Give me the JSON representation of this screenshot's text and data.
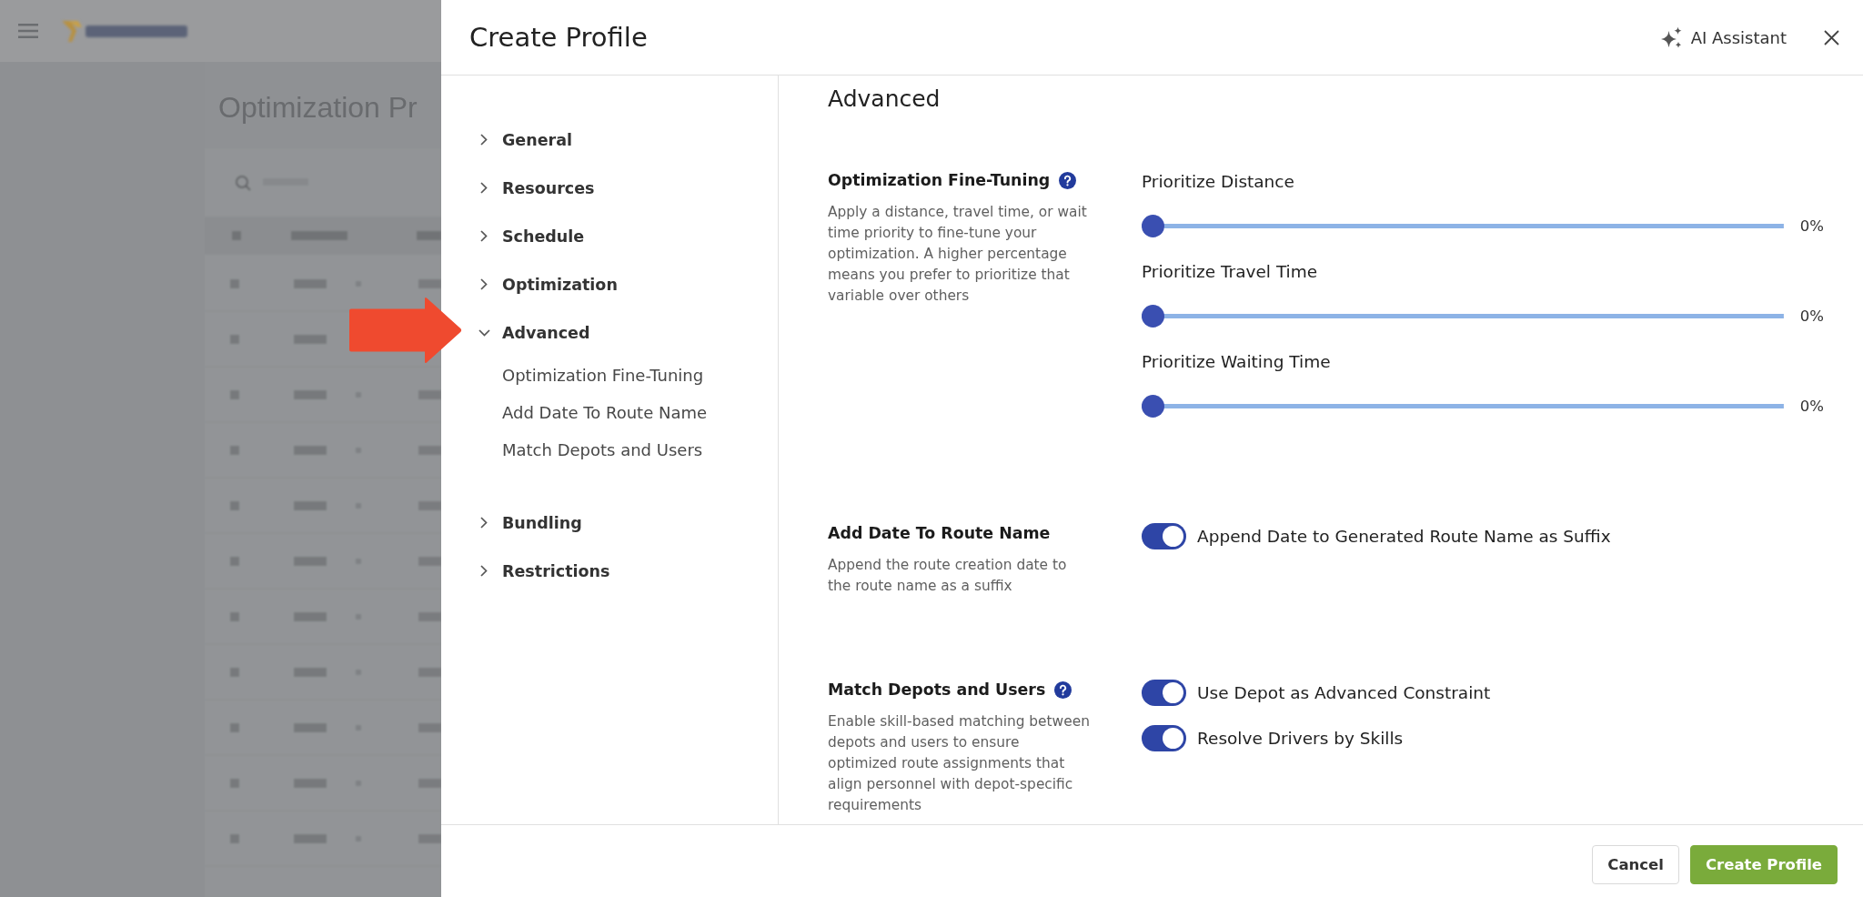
{
  "backdrop": {
    "page_title": "Optimization Pr"
  },
  "drawer": {
    "title": "Create Profile",
    "assistant_button": "AI Assistant"
  },
  "nav": {
    "items": [
      {
        "label": "General",
        "expanded": false
      },
      {
        "label": "Resources",
        "expanded": false
      },
      {
        "label": "Schedule",
        "expanded": false
      },
      {
        "label": "Optimization",
        "expanded": false
      },
      {
        "label": "Advanced",
        "expanded": true,
        "children": [
          {
            "label": "Optimization Fine-Tuning"
          },
          {
            "label": "Add Date To Route Name"
          },
          {
            "label": "Match Depots and Users"
          }
        ]
      },
      {
        "label": "Bundling",
        "expanded": false
      },
      {
        "label": "Restrictions",
        "expanded": false
      }
    ]
  },
  "content": {
    "heading": "Advanced",
    "sections": [
      {
        "title": "Optimization Fine-Tuning",
        "help": true,
        "description": "Apply a distance, travel time, or wait time priority to fine-tune your optimization. A higher percentage means you prefer to prioritize that variable over others",
        "controls": [
          {
            "kind": "slider",
            "label": "Prioritize Distance",
            "level": 0,
            "reading": "0%"
          },
          {
            "kind": "slider",
            "label": "Prioritize Travel Time",
            "level": 0,
            "reading": "0%"
          },
          {
            "kind": "slider",
            "label": "Prioritize Waiting Time",
            "level": 0,
            "reading": "0%"
          }
        ]
      },
      {
        "title": "Add Date To Route Name",
        "help": false,
        "description": "Append the route creation date to the route name as a suffix",
        "controls": [
          {
            "kind": "toggle",
            "label": "Append Date to Generated Route Name as Suffix",
            "on": true
          }
        ]
      },
      {
        "title": "Match Depots and Users",
        "help": true,
        "description": "Enable skill-based matching between depots and users to ensure optimized route assignments that align personnel with depot-specific requirements",
        "controls": [
          {
            "kind": "toggle",
            "label": "Use Depot as Advanced Constraint",
            "on": true
          },
          {
            "kind": "toggle",
            "label": "Resolve Drivers by Skills",
            "on": true
          }
        ]
      }
    ]
  },
  "footer": {
    "buttons": [
      {
        "label": "Cancel",
        "kind": "secondary"
      },
      {
        "label": "Create Profile",
        "kind": "primary"
      }
    ]
  }
}
